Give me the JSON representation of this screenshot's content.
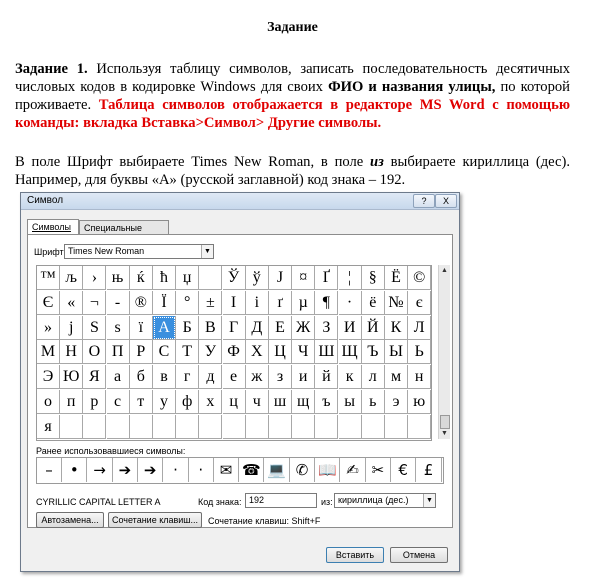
{
  "document": {
    "title": "Задание",
    "p1_a": "Задание 1.",
    "p1_b": " Используя таблицу символов, записать последовательность десятичных числовых кодов в кодировке Windows для своих ",
    "p1_c": "ФИО и названия улицы,",
    "p1_d": " по которой проживаете. ",
    "p1_e": "Таблица символов отображается в редакторе MS Word с помощью команды: вкладка Вставка>Символ> Другие символы.",
    "p2_a": "В поле Шрифт выбираете Times New Roman, в поле ",
    "p2_b": "из",
    "p2_c": " выбираете кириллица (дес). Например, для буквы «А» (русской заглавной) код знака – 192."
  },
  "dialog": {
    "title": "Символ",
    "help_label": "?",
    "close_label": "X",
    "tab_symbols": "Символы",
    "tab_special": "Специальные знаки",
    "font_label": "Шрифт:",
    "font_value": "Times New Roman",
    "recent_label": "Ранее использовавшиеся символы:",
    "char_name": "CYRILLIC CAPITAL LETTER A",
    "code_label": "Код знака:",
    "code_value": "192",
    "from_label": "из:",
    "from_value": "кириллица (дес.)",
    "autocorrect_label": "Автозамена...",
    "shortcut_btn_label": "Сочетание клавиш...",
    "shortcut_text": "Сочетание клавиш: Shift+F",
    "insert_label": "Вставить",
    "cancel_label": "Отмена",
    "selected_char": "А",
    "grid": [
      [
        "™",
        "љ",
        "›",
        "њ",
        "ќ",
        "ћ",
        "џ",
        " ",
        "Ў",
        "ў",
        "Ј",
        "¤",
        "Ґ",
        "¦",
        "§",
        "Ё",
        "©"
      ],
      [
        "Є",
        "«",
        "¬",
        "-",
        "®",
        "Ї",
        "°",
        "±",
        "І",
        "і",
        "ґ",
        "µ",
        "¶",
        "·",
        "ё",
        "№",
        "є"
      ],
      [
        "»",
        "ј",
        "Ѕ",
        "ѕ",
        "ї",
        "А",
        "Б",
        "В",
        "Г",
        "Д",
        "Е",
        "Ж",
        "З",
        "И",
        "Й",
        "К",
        "Л"
      ],
      [
        "М",
        "Н",
        "О",
        "П",
        "Р",
        "С",
        "Т",
        "У",
        "Ф",
        "Х",
        "Ц",
        "Ч",
        "Ш",
        "Щ",
        "Ъ",
        "Ы",
        "Ь"
      ],
      [
        "Э",
        "Ю",
        "Я",
        "а",
        "б",
        "в",
        "г",
        "д",
        "е",
        "ж",
        "з",
        "и",
        "й",
        "к",
        "л",
        "м",
        "н"
      ],
      [
        "о",
        "п",
        "р",
        "с",
        "т",
        "у",
        "ф",
        "х",
        "ц",
        "ч",
        "ш",
        "щ",
        "ъ",
        "ы",
        "ь",
        "э",
        "ю"
      ],
      [
        "я",
        "",
        "",
        "",
        "",
        "",
        "",
        "",
        "",
        "",
        "",
        "",
        "",
        "",
        "",
        "",
        ""
      ]
    ],
    "recent": [
      "–",
      "•",
      "→",
      "➔",
      "➔",
      "·",
      "·",
      "✉",
      "☎",
      "💻",
      "✆",
      "📖",
      "✍",
      "✂",
      "€",
      "£"
    ]
  }
}
